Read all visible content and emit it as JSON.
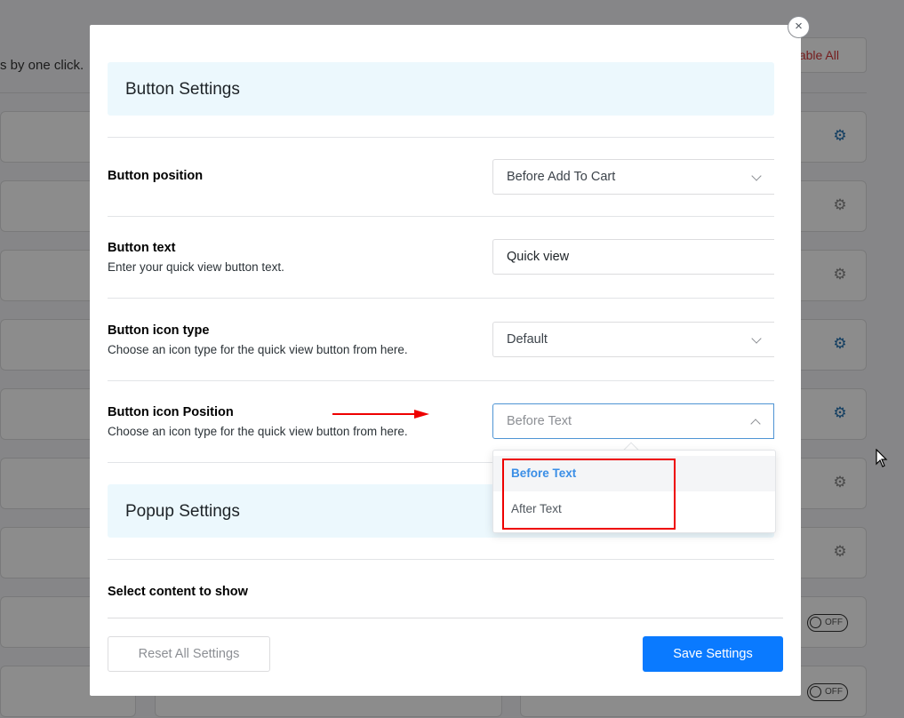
{
  "background": {
    "tagline": "s by one click.",
    "disable_all_label": "able All",
    "toggle_label": "OFF"
  },
  "modal": {
    "close_label": "×",
    "button_settings": {
      "heading": "Button Settings",
      "position": {
        "title": "Button position",
        "value": "Before Add To Cart"
      },
      "text": {
        "title": "Button text",
        "description": "Enter your quick view button text.",
        "value": "Quick view"
      },
      "icon_type": {
        "title": "Button icon type",
        "description": "Choose an icon type for the quick view button from here.",
        "value": "Default"
      },
      "icon_position": {
        "title": "Button icon Position",
        "description": "Choose an icon type for the quick view button from here.",
        "value": "Before Text",
        "options": [
          "Before Text",
          "After Text"
        ]
      }
    },
    "popup_settings": {
      "heading": "Popup Settings",
      "select_content_title": "Select content to show"
    },
    "footer": {
      "reset_label": "Reset All Settings",
      "save_label": "Save Settings"
    }
  },
  "colors": {
    "accent": "#0a7aff",
    "section_bg": "#ecf8fd",
    "annotation": "#e00000"
  }
}
